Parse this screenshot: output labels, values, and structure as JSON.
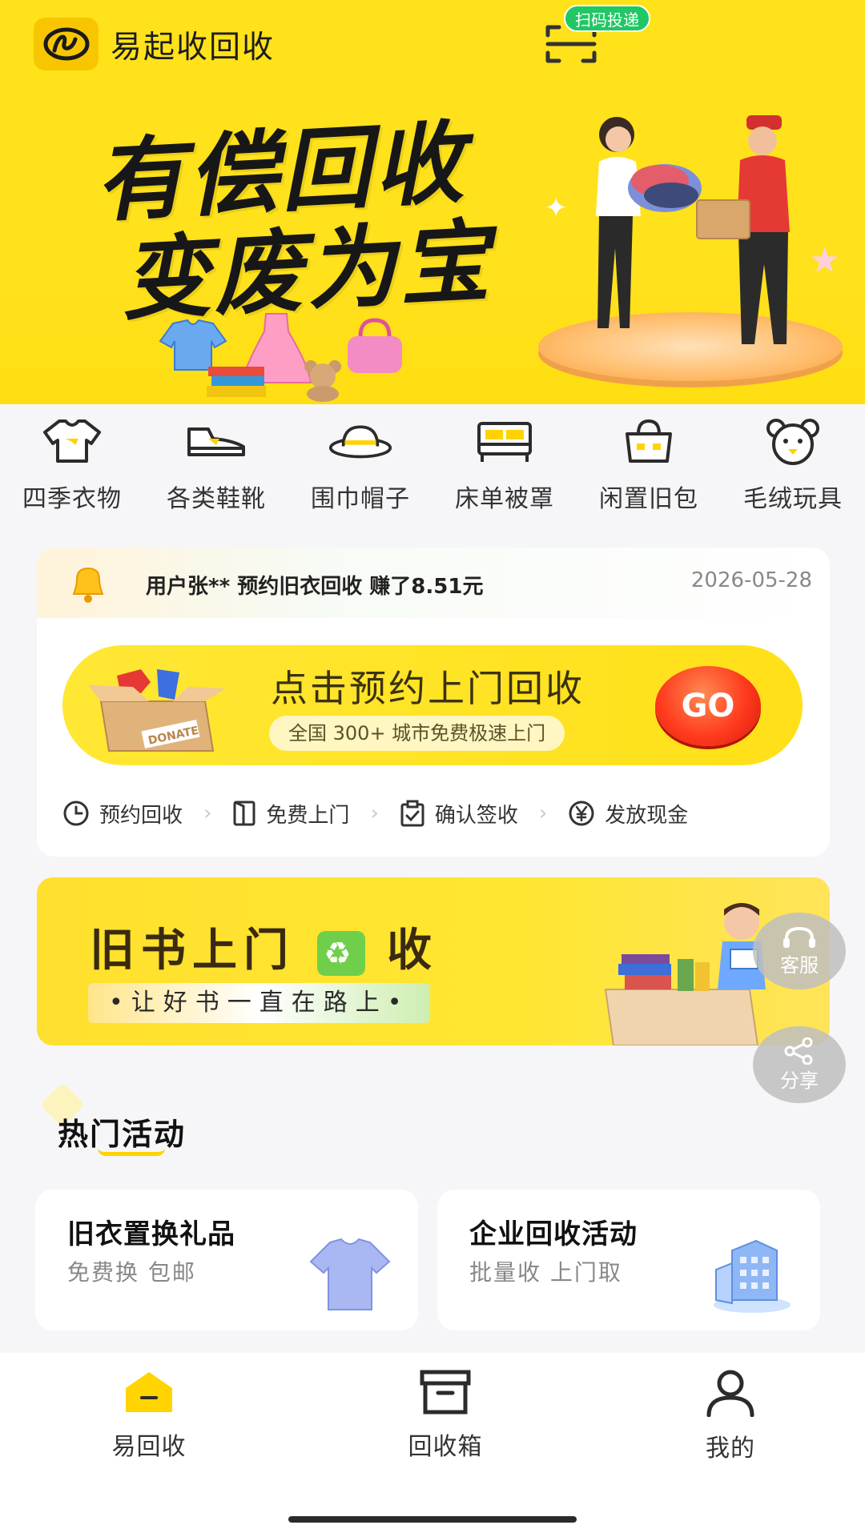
{
  "app": {
    "title": "易起收回收",
    "scan_badge": "扫码投递"
  },
  "hero": {
    "slogan_line1": "有偿回收",
    "slogan_line2": "变废为宝"
  },
  "categories": [
    {
      "label": "四季衣物",
      "icon": "tshirt-icon"
    },
    {
      "label": "各类鞋靴",
      "icon": "shoe-icon"
    },
    {
      "label": "围巾帽子",
      "icon": "hat-icon"
    },
    {
      "label": "床单被罩",
      "icon": "bed-icon"
    },
    {
      "label": "闲置旧包",
      "icon": "bag-icon"
    },
    {
      "label": "毛绒玩具",
      "icon": "bear-icon"
    }
  ],
  "notice": {
    "text": "用户张** 预约旧衣回收  赚了8.51元",
    "date": "2026-05-28"
  },
  "booking": {
    "title": "点击预约上门回收",
    "subtitle": "全国 300+ 城市免费极速上门",
    "go_label": "GO",
    "box_label": "DONATE",
    "steps": [
      {
        "label": "预约回收",
        "icon": "clock-icon"
      },
      {
        "label": "免费上门",
        "icon": "door-icon"
      },
      {
        "label": "确认签收",
        "icon": "clipboard-check-icon"
      },
      {
        "label": "发放现金",
        "icon": "yen-icon"
      }
    ]
  },
  "books_banner": {
    "title_part1": "旧书上门",
    "title_part2": "收",
    "subtitle": "•让好书一直在路上•"
  },
  "floating": {
    "customer_service": "客服",
    "share": "分享"
  },
  "hot": {
    "title": "热门活动",
    "activities": [
      {
        "title": "旧衣置换礼品",
        "subtitle": "免费换 包邮"
      },
      {
        "title": "企业回收活动",
        "subtitle": "批量收 上门取"
      }
    ]
  },
  "tabbar": {
    "items": [
      {
        "label": "易回收",
        "icon": "home-icon"
      },
      {
        "label": "回收箱",
        "icon": "box-icon"
      },
      {
        "label": "我的",
        "icon": "user-icon"
      }
    ]
  },
  "colors": {
    "brand_yellow": "#ffe21a",
    "go_red": "#ff3b1e",
    "badge_green": "#20c764"
  }
}
